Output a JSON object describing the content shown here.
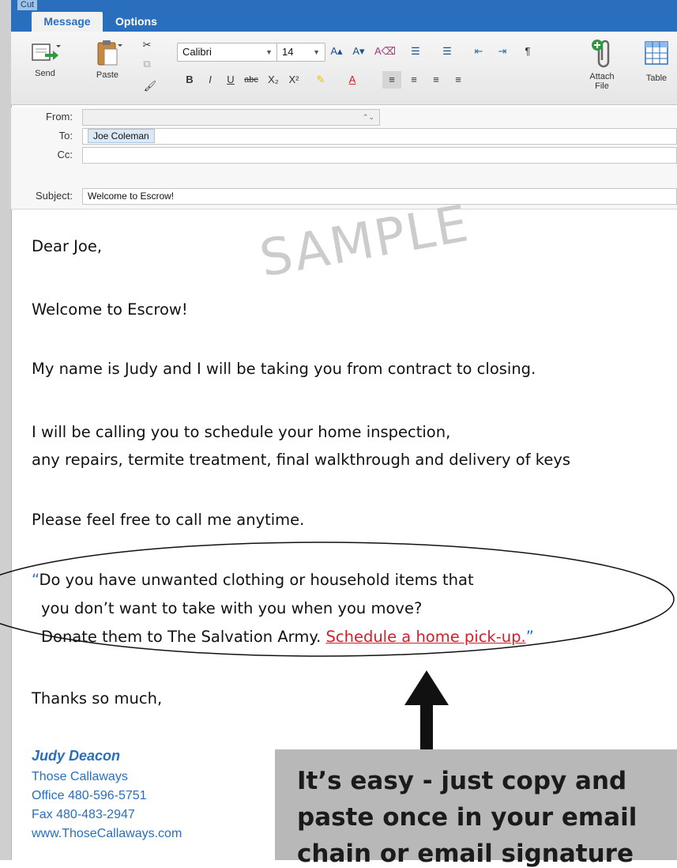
{
  "toolbar": {
    "cut_label": "Cut",
    "tabs": [
      {
        "label": "Message"
      },
      {
        "label": "Options"
      }
    ],
    "send_label": "Send",
    "paste_label": "Paste",
    "font_name": "Calibri",
    "font_size": "14",
    "attach_label_1": "Attach",
    "attach_label_2": "File",
    "table_label": "Table"
  },
  "header": {
    "from_label": "From:",
    "to_label": "To:",
    "to_value": "Joe Coleman",
    "cc_label": "Cc:",
    "subject_label": "Subject:",
    "subject_value": "Welcome to Escrow!"
  },
  "body": {
    "greeting": "Dear Joe,",
    "welcome": "Welcome to Escrow!",
    "intro": "My name is Judy and I will be taking you from contract to closing.",
    "calling_1": "I will be calling you to schedule your home inspection,",
    "calling_2": "any repairs, termite treatment, final walkthrough and delivery of keys",
    "call_anytime": "Please feel free to call me anytime.",
    "quote_open": "“",
    "donate_1": "Do you have unwanted clothing or household items that",
    "donate_2": "you don’t want to take with you when you move?",
    "donate_3": "Donate them to The Salvation Army. ",
    "donate_link": "Schedule a home pick-up.",
    "quote_close": "”",
    "closing": "Thanks so much,",
    "watermark": "SAMPLE"
  },
  "signature": {
    "name": "Judy Deacon",
    "company": "Those Callaways",
    "office": "Office 480-596-5751",
    "fax": "Fax 480-483-2947",
    "website": "www.ThoseCallaways.com"
  },
  "callout": {
    "line_1": "It’s easy - just copy and",
    "line_2": "paste once in your email",
    "line_3": "chain or email signature"
  },
  "colors": {
    "ribbon_blue": "#2a6fbe",
    "link_red": "#d0202a",
    "signature_blue": "#2a6fbe",
    "callout_gray": "#b8b8b8"
  }
}
